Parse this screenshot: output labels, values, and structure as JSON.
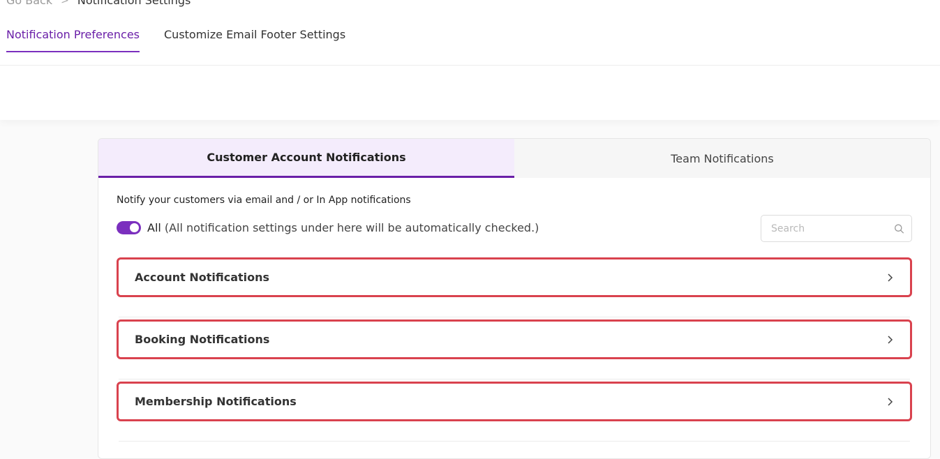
{
  "breadcrumb": {
    "back_label": "Go Back",
    "separator": ">",
    "current_label": "Notification Settings"
  },
  "page_tabs": [
    {
      "label": "Notification Preferences",
      "active": true
    },
    {
      "label": "Customize Email Footer Settings",
      "active": false
    }
  ],
  "card": {
    "tabs": [
      {
        "label": "Customer Account Notifications",
        "active": true
      },
      {
        "label": "Team Notifications",
        "active": false
      }
    ],
    "intro_text": "Notify your customers via email and / or In App notifications",
    "all_toggle": {
      "label": "All",
      "description": "(All notification settings under here will be automatically checked.)",
      "on": true
    },
    "search": {
      "placeholder": "Search",
      "value": ""
    },
    "sections": [
      {
        "label": "Account Notifications"
      },
      {
        "label": "Booking Notifications"
      },
      {
        "label": "Membership Notifications"
      }
    ]
  },
  "colors": {
    "accent": "#6a1fa8",
    "active_tab_bg": "#f4ecfc",
    "highlight_border": "#d9424e"
  },
  "icons": {
    "search": "search-icon",
    "chevron": "chevron-right-icon",
    "breadcrumb_separator": "chevron-right-icon"
  }
}
